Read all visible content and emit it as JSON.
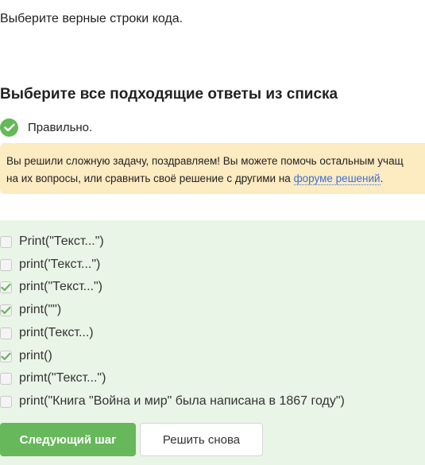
{
  "question": {
    "text": "Выберите верные строки кода."
  },
  "section_title": "Выберите все подходящие ответы из списка",
  "result": {
    "label": "Правильно.",
    "icon": "check-circle-icon",
    "color": "#66b85a"
  },
  "notice": {
    "text_before": "Вы решили сложную задачу, поздравляем! Вы можете помочь остальным учащ",
    "text_line2": "на их вопросы, или сравнить своё решение с другими на ",
    "link_text": "форуме решений",
    "text_after": "."
  },
  "options": [
    {
      "label": "Print(\"Текст...\")",
      "checked": false
    },
    {
      "label": "print('Текст...\")",
      "checked": false
    },
    {
      "label": "print(\"Текст...\")",
      "checked": true
    },
    {
      "label": "print(\"\")",
      "checked": true
    },
    {
      "label": "print(Текст...)",
      "checked": false
    },
    {
      "label": "print()",
      "checked": true
    },
    {
      "label": "primt(\"Текст...\")",
      "checked": false
    },
    {
      "label": "print(\"Книга \"Война и мир\" была написана в 1867 году\")",
      "checked": false
    }
  ],
  "buttons": {
    "next_label": "Следующий шаг",
    "retry_label": "Решить снова"
  },
  "colors": {
    "accent": "#66b85a",
    "panel_bg": "#e9f5e6",
    "notice_bg": "#fdebc2",
    "link": "#3a6fd8"
  }
}
